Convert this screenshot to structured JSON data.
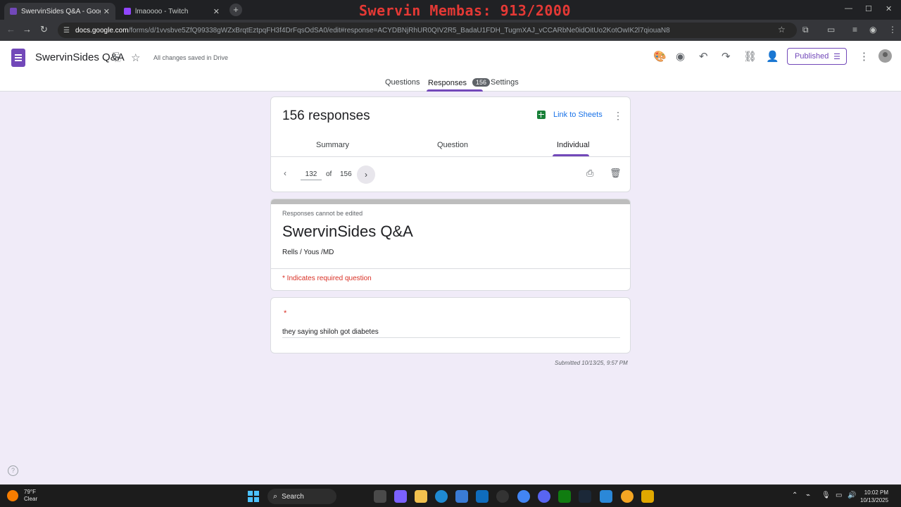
{
  "browser": {
    "tabs": [
      {
        "title": "SwervinSides Q&A - Google Fo",
        "close": "✕"
      },
      {
        "title": "lmaoooo - Twitch",
        "close": "✕"
      }
    ],
    "new_tab": "+",
    "url_host": "docs.google.com",
    "url_path": "/forms/d/1vvsbve5ZfQ99338gWZxBrqtEztpqFH3f4DrFqsOdSA0/edit#response=ACYDBNjRhUR0QIV2R5_BadaU1FDH_TugmXAJ_vCCARbNe0idOitUo2KotOwIK2l7qiouaN8",
    "window_controls": {
      "minimize": "—",
      "maximize": "☐",
      "close": "✕"
    }
  },
  "stream_overlay": "Swervin Membas: 913/2000",
  "form_header": {
    "title": "SwervinSides Q&A",
    "saved_status": "All changes saved in Drive",
    "publish_label": "Published",
    "tabs": [
      {
        "label": "Questions"
      },
      {
        "label": "Responses",
        "badge": "156"
      },
      {
        "label": "Settings"
      }
    ]
  },
  "responses_card": {
    "title": "156 responses",
    "link_to_sheets": "Link to Sheets",
    "subtabs": [
      "Summary",
      "Question",
      "Individual"
    ],
    "current": "132",
    "of_label": "of",
    "total": "156"
  },
  "form_card": {
    "notice": "Responses cannot be edited",
    "title": "SwervinSides Q&A",
    "description": "Rells / Yous /MD",
    "required_note": "* Indicates required question"
  },
  "question_card": {
    "required_marker": "*",
    "answer": "they saying shiloh got diabetes"
  },
  "submitted": "Submitted 10/13/25, 9:57 PM",
  "taskbar": {
    "temperature": "79°F",
    "condition": "Clear",
    "search_label": "Search",
    "time": "10:02 PM",
    "date": "10/13/2025"
  },
  "colors": {
    "forms_purple": "#7248b9",
    "page_background": "#f0ebf8",
    "sheets_green": "#188038",
    "required_red": "#d93025",
    "overlay_red": "#e53935"
  }
}
